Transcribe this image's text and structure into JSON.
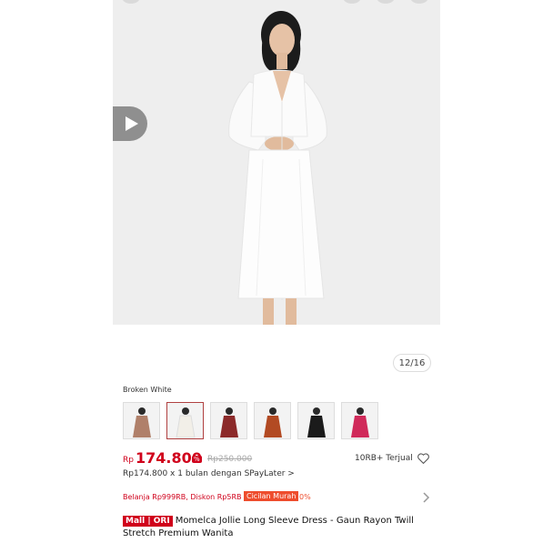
{
  "gallery": {
    "pager": "12/16"
  },
  "variant": {
    "label": "Broken White",
    "options": [
      {
        "name": "variant-brown",
        "color": "#b0806a"
      },
      {
        "name": "variant-broken-white",
        "color": "#f2efe8"
      },
      {
        "name": "variant-maroon",
        "color": "#8c2a2a"
      },
      {
        "name": "variant-rust",
        "color": "#b24a23"
      },
      {
        "name": "variant-black",
        "color": "#1b1b1b"
      },
      {
        "name": "variant-pink",
        "color": "#d02a5a"
      }
    ]
  },
  "price": {
    "currency": "Rp",
    "current": "174.800",
    "badge": "%",
    "original": "Rp250.000",
    "sold": "10RB+ Terjual"
  },
  "installment": "Rp174.800 x 1 bulan dengan SPayLater >",
  "promo": {
    "text": "Belanja Rp999RB, Diskon Rp5RB",
    "tag": "Cicilan Murah",
    "pct": "0%"
  },
  "product": {
    "badge": "Mall | ORI",
    "title": "Momelca Jollie Long Sleeve Dress - Gaun Rayon Twill Stretch Premium Wanita"
  },
  "colors": {
    "accent": "#d0011b",
    "orange": "#ee4d2d"
  }
}
